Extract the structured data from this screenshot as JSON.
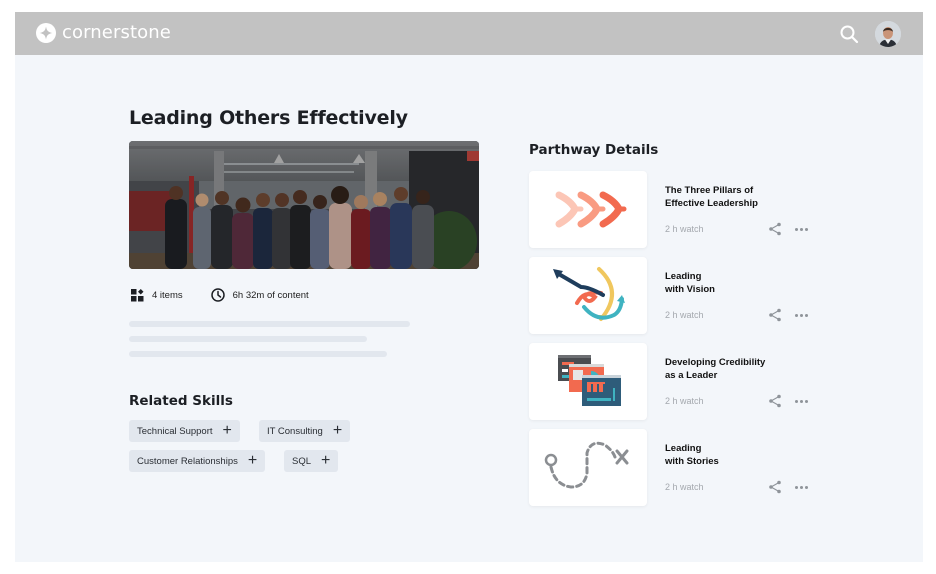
{
  "header": {
    "brand": "cornerstone",
    "icons": [
      "cornerstone-logo-icon",
      "search-icon",
      "user-avatar"
    ]
  },
  "course": {
    "title": "Leading Others Effectively",
    "image": "group-photo-team-in-office",
    "items_count": "4 items",
    "duration": "6h 32m of content"
  },
  "related_skills": {
    "title": "Related Skills",
    "skills": [
      {
        "label": "Technical Support"
      },
      {
        "label": "IT Consulting"
      },
      {
        "label": "Customer Relationships"
      },
      {
        "label": "SQL"
      }
    ]
  },
  "parthway": {
    "title": "Parthway Details",
    "items": [
      {
        "title_line1": "The Three Pillars of",
        "title_line2": "Effective Leadership",
        "duration": "2 h watch",
        "thumbnail": "chevrons-illustration"
      },
      {
        "title_line1": "Leading",
        "title_line2": "with Vision",
        "duration": "2 h watch",
        "thumbnail": "arrows-illustration"
      },
      {
        "title_line1": "Developing Credibility",
        "title_line2": "as a Leader",
        "duration": "2 h watch",
        "thumbnail": "windows-illustration"
      },
      {
        "title_line1": "Leading",
        "title_line2": "with Stories",
        "duration": "2 h watch",
        "thumbnail": "treasure-path-illustration"
      }
    ]
  },
  "colors": {
    "topbar": "#c2c2c2",
    "background": "#f3f6fa",
    "chip": "#e2e7ee",
    "accent_orange": "#f26a4f",
    "accent_teal": "#3fb3c1",
    "accent_navy": "#1f3d5c",
    "accent_yellow": "#f0c75e"
  }
}
